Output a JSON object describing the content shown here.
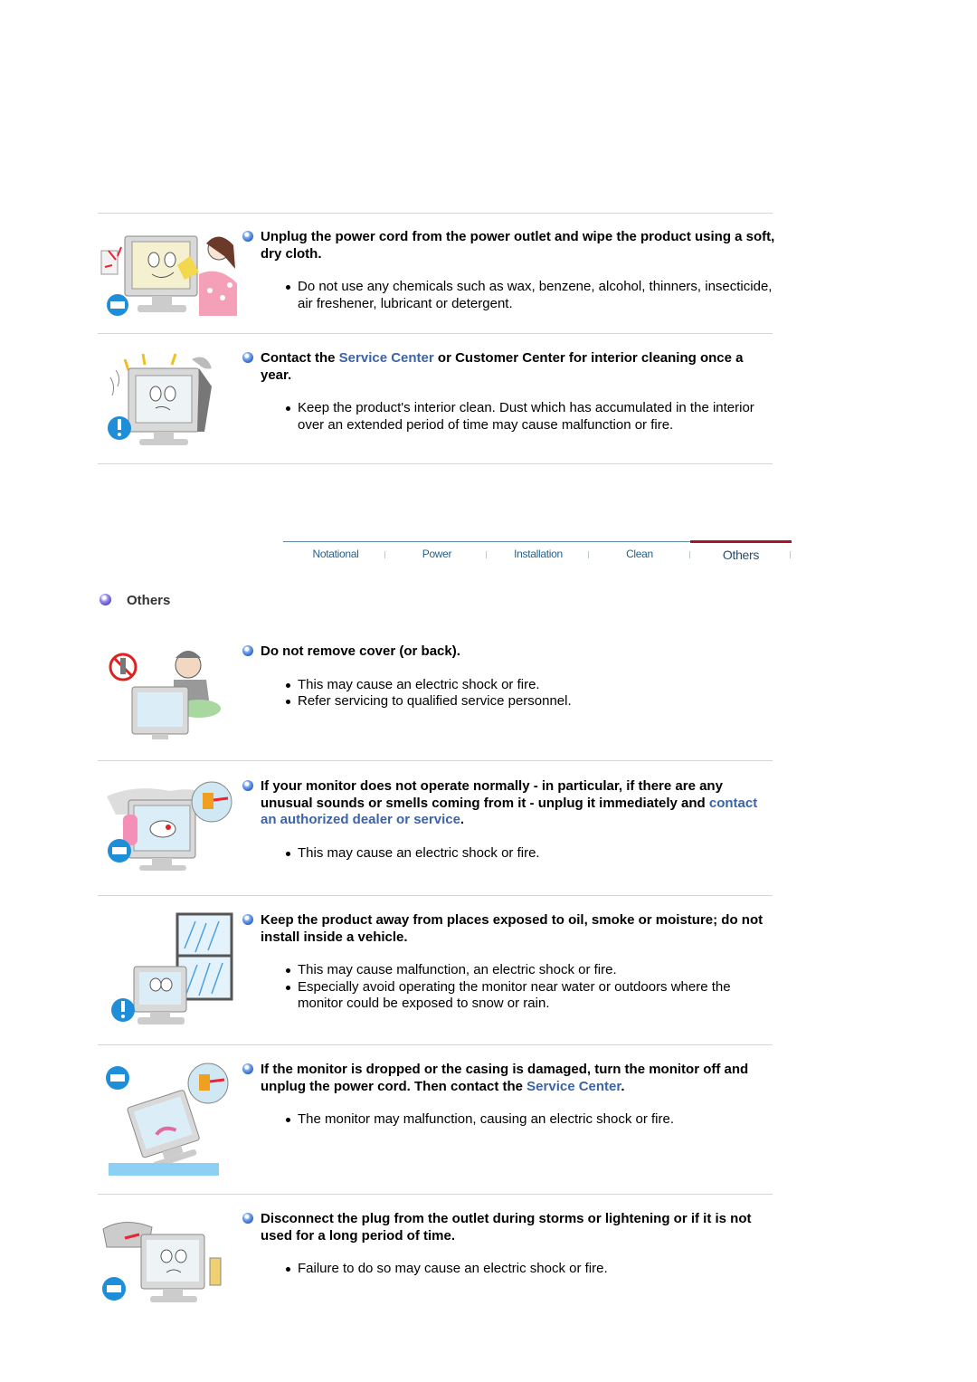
{
  "clean_items": [
    {
      "illustration": "monitor-wiping-cloth-unplug-illustration",
      "heading_parts": [
        {
          "text": "Unplug the power cord from the power outlet and wipe the product using a soft, dry cloth.",
          "link": false
        }
      ],
      "bullets": [
        "Do not use any chemicals such as wax, benzene, alcohol, thinners, insecticide, air freshener, lubricant or detergent."
      ]
    },
    {
      "illustration": "monitor-interior-cleaning-warning-illustration",
      "heading_parts": [
        {
          "text": "Contact the ",
          "link": false
        },
        {
          "text": "Service Center",
          "link": true
        },
        {
          "text": " or Customer Center for interior cleaning once a year.",
          "link": false
        }
      ],
      "bullets": [
        "Keep the product's interior clean. Dust which has accumulated in the interior over an extended period of time may cause malfunction or fire."
      ]
    }
  ],
  "tabs": {
    "items": [
      "Notational",
      "Power",
      "Installation",
      "Clean",
      "Others"
    ],
    "active": "Others"
  },
  "section_title": "Others",
  "others_items": [
    {
      "illustration": "do-not-remove-cover-illustration",
      "heading_parts": [
        {
          "text": "Do not remove cover (or back).",
          "link": false
        }
      ],
      "bullets": [
        "This may cause an electric shock or fire.",
        "Refer servicing to qualified service personnel."
      ]
    },
    {
      "illustration": "abnormal-operation-unplug-illustration",
      "heading_parts": [
        {
          "text": "If your monitor does not operate normally - in particular, if there are any unusual sounds or smells coming from it - unplug it immediately and ",
          "link": false
        },
        {
          "text": "contact an authorized dealer or service",
          "link": true
        },
        {
          "text": ".",
          "link": false
        }
      ],
      "bullets": [
        "This may cause an electric shock or fire."
      ]
    },
    {
      "illustration": "moisture-rain-window-illustration",
      "heading_parts": [
        {
          "text": "Keep the product away from places exposed to oil, smoke or moisture; do not install inside a vehicle.",
          "link": false
        }
      ],
      "bullets": [
        "This may cause malfunction, an electric shock or fire.",
        "Especially avoid operating the monitor near water or outdoors where the monitor could be exposed to snow or rain."
      ]
    },
    {
      "illustration": "dropped-monitor-illustration",
      "heading_parts": [
        {
          "text": "If the monitor is dropped or the casing is damaged, turn the monitor off and unplug the power cord. Then contact the ",
          "link": false
        },
        {
          "text": "Service Center",
          "link": true
        },
        {
          "text": ".",
          "link": false
        }
      ],
      "bullets": [
        "The monitor may malfunction, causing an electric shock or fire."
      ]
    },
    {
      "illustration": "storm-unplug-illustration",
      "heading_parts": [
        {
          "text": "Disconnect the plug from the outlet during storms or lightening or if it is not used for a long period of time.",
          "link": false
        }
      ],
      "bullets": [
        "Failure to do so may cause an electric shock or fire."
      ]
    }
  ]
}
